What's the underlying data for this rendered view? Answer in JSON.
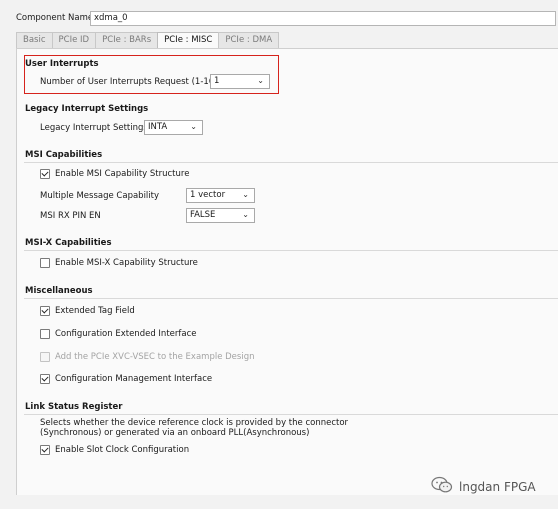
{
  "component": {
    "label": "Component Name",
    "value": "xdma_0"
  },
  "tabs": [
    "Basic",
    "PCIe ID",
    "PCIe : BARs",
    "PCIe : MISC",
    "PCIe : DMA"
  ],
  "user_interrupts": {
    "title": "User Interrupts",
    "request_label": "Number of User Interrupts Request (1-16)",
    "request_value": "1"
  },
  "legacy": {
    "title": "Legacy Interrupt Settings",
    "label": "Legacy Interrupt Settings",
    "value": "INTA"
  },
  "msi": {
    "title": "MSI Capabilities",
    "enable_label": "Enable MSI Capability Structure",
    "enable_checked": true,
    "mmc_label": "Multiple Message Capability",
    "mmc_value": "1 vector",
    "rx_label": "MSI RX PIN EN",
    "rx_value": "FALSE"
  },
  "msix": {
    "title": "MSI-X Capabilities",
    "enable_label": "Enable MSI-X Capability Structure",
    "enable_checked": false
  },
  "misc": {
    "title": "Miscellaneous",
    "items": [
      {
        "label": "Extended Tag Field",
        "checked": true,
        "disabled": false
      },
      {
        "label": "Configuration Extended Interface",
        "checked": false,
        "disabled": false
      },
      {
        "label": "Add the PCIe XVC-VSEC to the Example Design",
        "checked": false,
        "disabled": true
      },
      {
        "label": "Configuration Management Interface",
        "checked": true,
        "disabled": false
      }
    ]
  },
  "link_status": {
    "title": "Link Status Register",
    "desc_line1": "Selects whether the device reference clock is provided by the connector",
    "desc_line2": "(Synchronous) or generated via an onboard PLL(Asynchronous)",
    "slot_clock_label": "Enable Slot Clock Configuration",
    "slot_clock_checked": true
  },
  "watermark": {
    "text": "lngdan FPGA",
    "icon": "wechat-icon"
  },
  "colors": {
    "highlight": "#d6231c",
    "panel": "#fafafa"
  }
}
